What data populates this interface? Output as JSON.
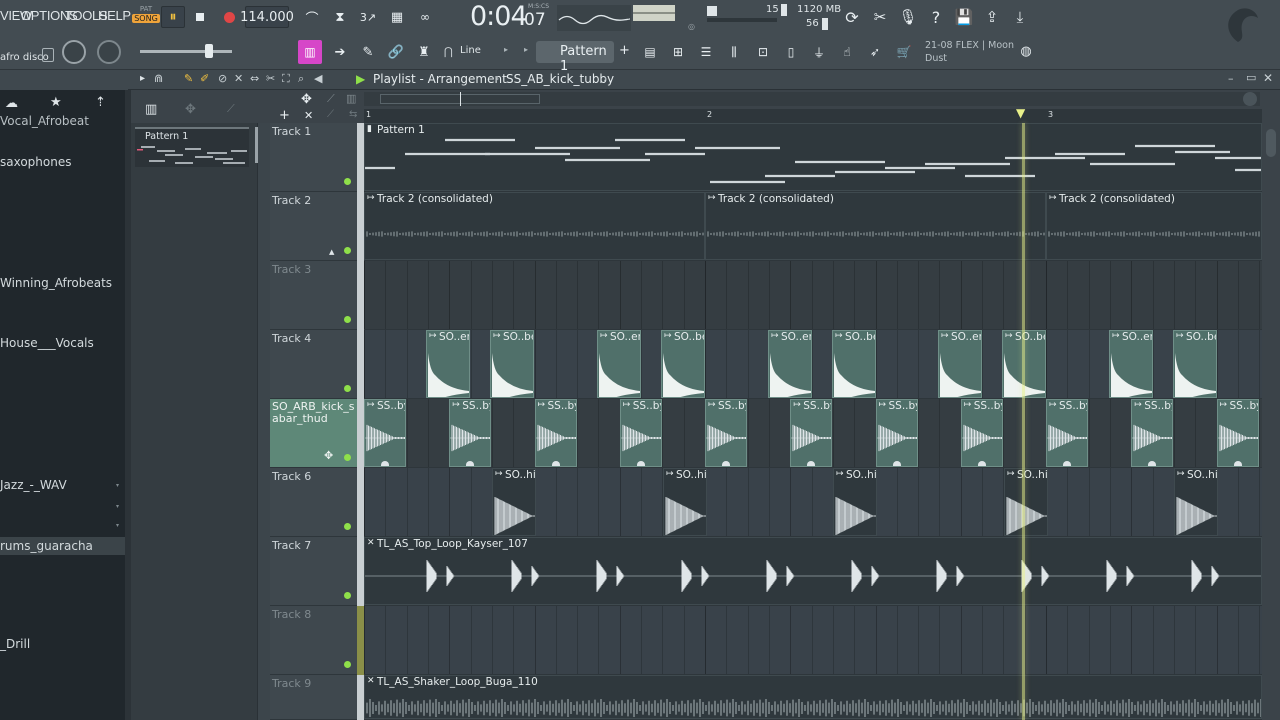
{
  "menu": {
    "view": "VIEW",
    "options": "OPTIONS",
    "tools": "TOOLS",
    "help": "HELP"
  },
  "transport": {
    "pat": "PAT",
    "song": "SONG",
    "tempo": "114.000",
    "time": "0:04",
    "time_small": "07",
    "time_unit": "M:S:CS"
  },
  "monitor": {
    "voices": "15",
    "memory": "1120 MB",
    "cpu": "56"
  },
  "news": {
    "line1": "21-08  FLEX | Moon",
    "line2": "Dust"
  },
  "pattern_selector": {
    "label": "Pattern 1",
    "snap": "Line"
  },
  "preset": {
    "name": "afro disco"
  },
  "playlist": {
    "title": "Playlist - Arrangement",
    "crumb": "SS_AB_kick_tubby"
  },
  "ruler": {
    "marks": [
      "1",
      "2",
      "3"
    ]
  },
  "picker": {
    "pattern": "Pattern 1"
  },
  "browser": {
    "items": [
      "Vocal_Afrobeat",
      "saxophones",
      "Winning_Afrobeats",
      "House___Vocals",
      "Jazz_-_WAV",
      "rums_guaracha",
      "_Drill"
    ],
    "selected": "rums_guaracha"
  },
  "tracks": [
    {
      "name": "Track 1"
    },
    {
      "name": "Track 2"
    },
    {
      "name": "Track 3"
    },
    {
      "name": "Track 4"
    },
    {
      "name": "SO_ARB_kick_sabar_thud"
    },
    {
      "name": "Track 6"
    },
    {
      "name": "Track 7"
    },
    {
      "name": "Track 8"
    },
    {
      "name": "Track 9"
    }
  ],
  "clips": {
    "pattern1": "Pattern 1",
    "track2": "Track 2 (consolidated)",
    "track4a": "SO..er",
    "track4b": "SO..ber",
    "kick": "SS..by",
    "track6": "SO..hit",
    "track7": "TL_AS_Top_Loop_Kayser_107",
    "track9": "TL_AS_Shaker_Loop_Buga_110"
  },
  "colors": {
    "accent": "#8fe04a",
    "playhead": "#e8f08a",
    "toolbar": "#434c52"
  }
}
